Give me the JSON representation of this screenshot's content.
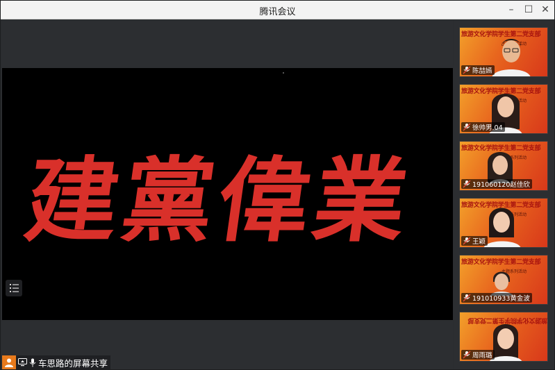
{
  "window": {
    "title": "腾讯会议",
    "minimize_symbol": "–",
    "maximize_symbol": "☐",
    "close_symbol": "✕"
  },
  "share": {
    "calligraphy_text": "建黨偉業",
    "sharer_label": "车思路的屏幕共享"
  },
  "banner": {
    "line1": "旅游文化学院学生第二党支部",
    "line2": "主题系列活动"
  },
  "participants": [
    {
      "name": "陈喆嫣"
    },
    {
      "name": "徐帅男.04"
    },
    {
      "name": "191060120赵佳欣"
    },
    {
      "name": "王颖"
    },
    {
      "name": "191010933黄金波"
    },
    {
      "name": "周雨璐"
    }
  ],
  "colors": {
    "calligraphy": "#d9302a",
    "accent_orange": "#e87a1c",
    "banner_text": "#a8140f"
  }
}
